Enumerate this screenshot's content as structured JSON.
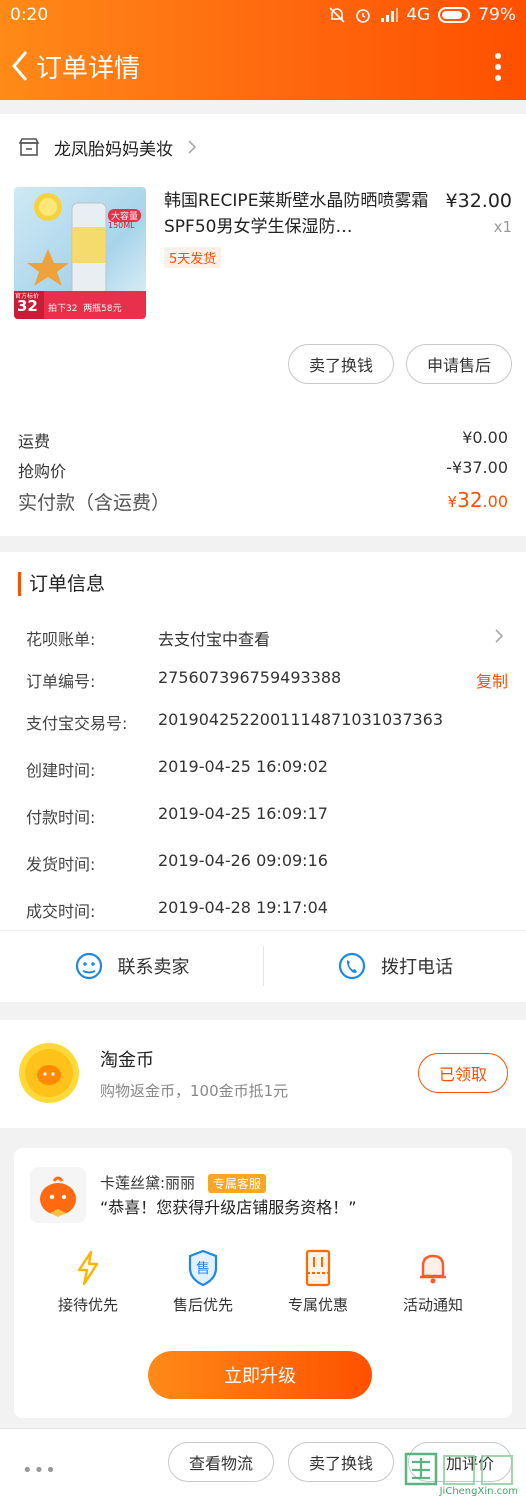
{
  "status_bar": {
    "time": "0:20",
    "network": "4G",
    "battery": "79%"
  },
  "header": {
    "title": "订单详情"
  },
  "store": {
    "name": "龙凤胎妈妈美妆"
  },
  "product": {
    "title": "韩国RECIPE莱斯壁水晶防晒喷雾霜SPF50男女学生保湿防…",
    "price": "¥32.00",
    "qty": "x1",
    "ship_tag": "5天发货",
    "thumb_badge_top": "大容量",
    "thumb_badge_vol": "150ML",
    "thumb_price": "32",
    "thumb_price_label": "官方标价",
    "thumb_promo": "拍下32  两瓶58元"
  },
  "product_actions": {
    "sell": "卖了换钱",
    "after_sale": "申请售后"
  },
  "fees": [
    {
      "label": "运费",
      "value": "¥0.00"
    },
    {
      "label": "抢购价",
      "value": "-¥37.00"
    }
  ],
  "paid": {
    "label": "实付款（含运费）",
    "currency": "¥",
    "amount": "32",
    "cents": ".00"
  },
  "order_info": {
    "title": "订单信息",
    "rows": [
      {
        "label": "花呗账单:",
        "value": "去支付宝中查看",
        "action": ""
      },
      {
        "label": "订单编号:",
        "value": "275607396759493388",
        "action": "复制"
      },
      {
        "label": "支付宝交易号:",
        "value": "2019042522001114871031037363",
        "action": ""
      },
      {
        "label": "创建时间:",
        "value": "2019-04-25 16:09:02",
        "action": ""
      },
      {
        "label": "付款时间:",
        "value": "2019-04-25 16:09:17",
        "action": ""
      },
      {
        "label": "发货时间:",
        "value": "2019-04-26 09:09:16",
        "action": ""
      },
      {
        "label": "成交时间:",
        "value": "2019-04-28 19:17:04",
        "action": ""
      }
    ]
  },
  "contact": {
    "seller": "联系卖家",
    "phone": "拨打电话"
  },
  "coin": {
    "title": "淘金币",
    "subtitle": "购物返金币，100金币抵1元",
    "button": "已领取"
  },
  "upgrade": {
    "cs_name": "卡莲丝黛:丽丽",
    "cs_badge": "专属客服",
    "message": "“恭喜！您获得升级店铺服务资格！”",
    "perks": [
      "接待优先",
      "售后优先",
      "专属优惠",
      "活动通知"
    ],
    "perk_icon_label": "售",
    "button": "立即升级"
  },
  "bottom_bar": {
    "logistics": "查看物流",
    "sell": "卖了换钱",
    "review": "加评价"
  },
  "watermark": {
    "text": "JiChengXin.com"
  },
  "colors": {
    "accent": "#ff5000",
    "gradient_start": "#ff8a17",
    "perk_blue": "#1e88e5",
    "perk_orange": "#ff6a00"
  }
}
